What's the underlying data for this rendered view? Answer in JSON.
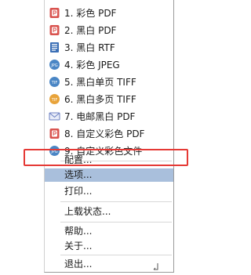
{
  "menu": {
    "export_items": [
      {
        "label": "1. 彩色 PDF",
        "icon": "pdf-icon"
      },
      {
        "label": "2. 黑白 PDF",
        "icon": "pdf-icon"
      },
      {
        "label": "3. 黑白 RTF",
        "icon": "rtf-icon"
      },
      {
        "label": "4. 彩色 JPEG",
        "icon": "jpeg-icon"
      },
      {
        "label": "5. 黑白单页 TIFF",
        "icon": "tiff-icon"
      },
      {
        "label": "6. 黑白多页 TIFF",
        "icon": "tiff-multipage-icon"
      },
      {
        "label": "7. 电邮黑白 PDF",
        "icon": "email-icon"
      },
      {
        "label": "8. 自定义彩色 PDF",
        "icon": "pdf-icon"
      },
      {
        "label": "9. 自定义彩色文件",
        "icon": "image-file-icon"
      }
    ],
    "config_label": "配置...",
    "options_label": "选项...",
    "print_label": "打印...",
    "upload_status_label": "上载状态...",
    "help_label": "帮助...",
    "about_label": "关于...",
    "exit_label": "退出..."
  },
  "colors": {
    "selection": "#a9bfdc",
    "highlight_border": "#e53935",
    "pdf_red": "#d9534f",
    "doc_blue": "#3b6fb6",
    "jpeg_blue": "#4a86c5",
    "tiff_orange": "#e8a33a",
    "mail_blue": "#6b7fc2"
  }
}
